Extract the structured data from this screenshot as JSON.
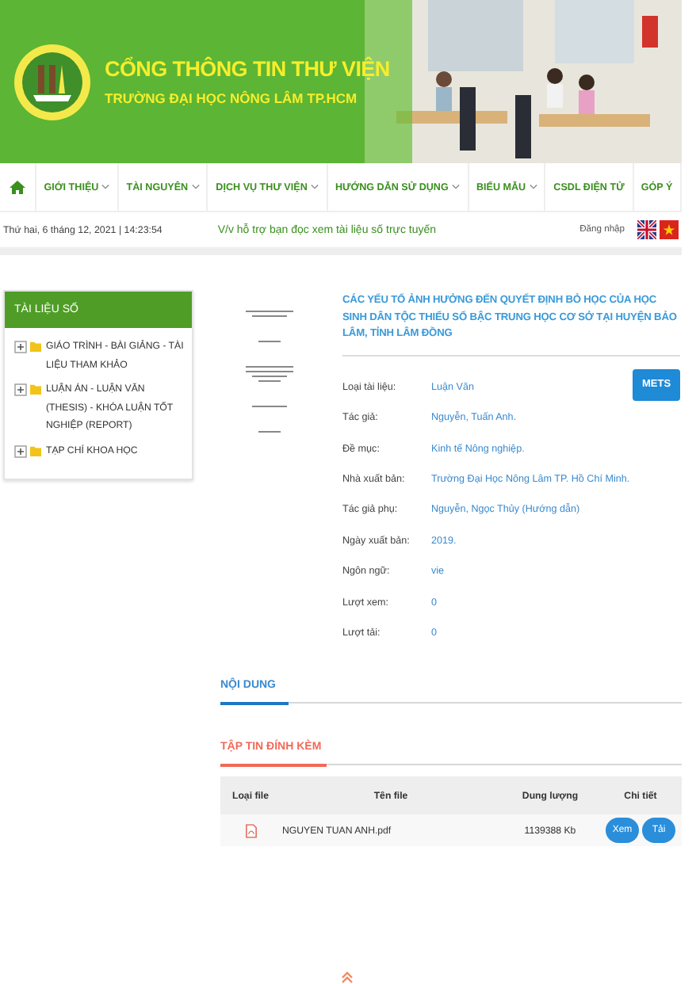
{
  "header": {
    "title": "CỔNG THÔNG TIN THƯ VIỆN",
    "subtitle": "TRƯỜNG ĐẠI HỌC NÔNG LÂM TP.HCM"
  },
  "nav": [
    {
      "kind": "home"
    },
    {
      "kind": "text",
      "label": "GIỚI THIỆU",
      "dropdown": true
    },
    {
      "kind": "text",
      "label": "TÀI NGUYÊN",
      "dropdown": true
    },
    {
      "kind": "text",
      "label": "DỊCH VỤ THƯ VIỆN",
      "dropdown": true
    },
    {
      "kind": "text",
      "label": "HƯỚNG DẪN SỬ DỤNG",
      "dropdown": true
    },
    {
      "kind": "text",
      "label": "BIỂU MẪU",
      "dropdown": true
    },
    {
      "kind": "text",
      "label": "CSDL ĐIỆN TỬ",
      "dropdown": false
    },
    {
      "kind": "text",
      "label": "GÓP Ý",
      "dropdown": false
    }
  ],
  "info_bar": {
    "date": "Thứ hai, 6 tháng 12, 2021 | 14:23:54",
    "notice": "V/v hỗ trợ bạn đọc xem tài liệu số trực tuyến",
    "login": "Đăng nhập"
  },
  "sidebar": {
    "title": "TÀI LIỆU SỐ",
    "items": [
      {
        "label": "GIÁO TRÌNH - BÀI GIẢNG - TÀI LIỆU THAM KHẢO"
      },
      {
        "label": "LUẬN ÁN - LUẬN VĂN (THESIS) - KHÓA LUẬN TỐT NGHIỆP (REPORT)"
      },
      {
        "label": "TẠP CHÍ KHOA HỌC"
      }
    ]
  },
  "document": {
    "title": "CÁC YẾU TỐ ẢNH HƯỞNG ĐẾN QUYẾT ĐỊNH BỎ HỌC CỦA HỌC SINH DÂN TỘC THIỂU SỐ BẬC TRUNG HỌC CƠ SỞ TẠI HUYỆN BẢO LÂM, TỈNH LÂM ĐỒNG",
    "button": "METS",
    "fields": [
      {
        "label": "Loại tài liệu:",
        "value": "Luận Văn"
      },
      {
        "label": "Tác giả:",
        "value": "Nguyễn, Tuấn Anh."
      },
      {
        "label": "Đề mục:",
        "value": "Kinh tế Nông nghiệp."
      },
      {
        "label": "Nhà xuất bản:",
        "value": "Trường Đại Học Nông Lâm TP. Hồ Chí Minh."
      },
      {
        "label": "Tác giả phụ:",
        "value": "Nguyễn, Ngọc Thủy (Hướng dẫn)"
      },
      {
        "label": "Ngày xuất bản:",
        "value": "2019."
      },
      {
        "label": "Ngôn ngữ:",
        "value": "vie"
      },
      {
        "label": "Lượt xem:",
        "value": "0"
      },
      {
        "label": "Lượt tải:",
        "value": "0"
      }
    ]
  },
  "content_heading": "NỘI DUNG",
  "attachments": {
    "heading": "TẬP TIN ĐÍNH KÈM",
    "columns": [
      "Loại file",
      "Tên file",
      "Dung lượng",
      "Chi tiết"
    ],
    "rows": [
      {
        "name": "NGUYEN TUAN ANH.pdf",
        "size": "1139388 Kb",
        "actions": [
          "Xem",
          "Tải"
        ]
      }
    ]
  }
}
